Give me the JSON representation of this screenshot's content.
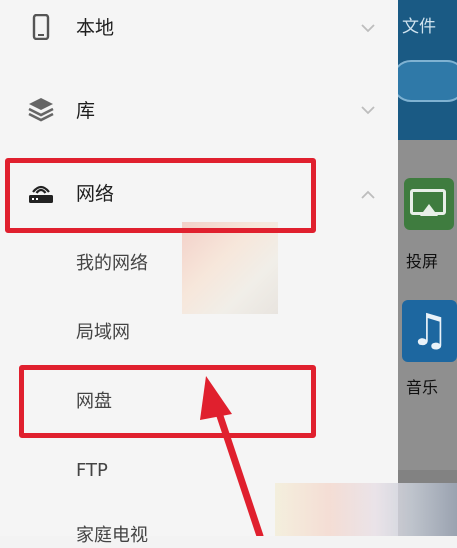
{
  "drawer": {
    "items": [
      {
        "label": "本地",
        "icon": "phone-icon",
        "expanded": false
      },
      {
        "label": "库",
        "icon": "layers-icon",
        "expanded": false
      },
      {
        "label": "网络",
        "icon": "router-icon",
        "expanded": true
      }
    ],
    "network_subitems": [
      "我的网络",
      "局域网",
      "网盘",
      "FTP",
      "家庭电视"
    ]
  },
  "background_app": {
    "header_text": "文件",
    "tiles": [
      {
        "label": "投屏",
        "icon": "cast-icon"
      },
      {
        "label": "音乐",
        "icon": "music-note-icon",
        "glyph": "♫"
      }
    ]
  },
  "annotation": {
    "color": "#e0202e",
    "highlighted": [
      "网络",
      "网盘"
    ]
  }
}
